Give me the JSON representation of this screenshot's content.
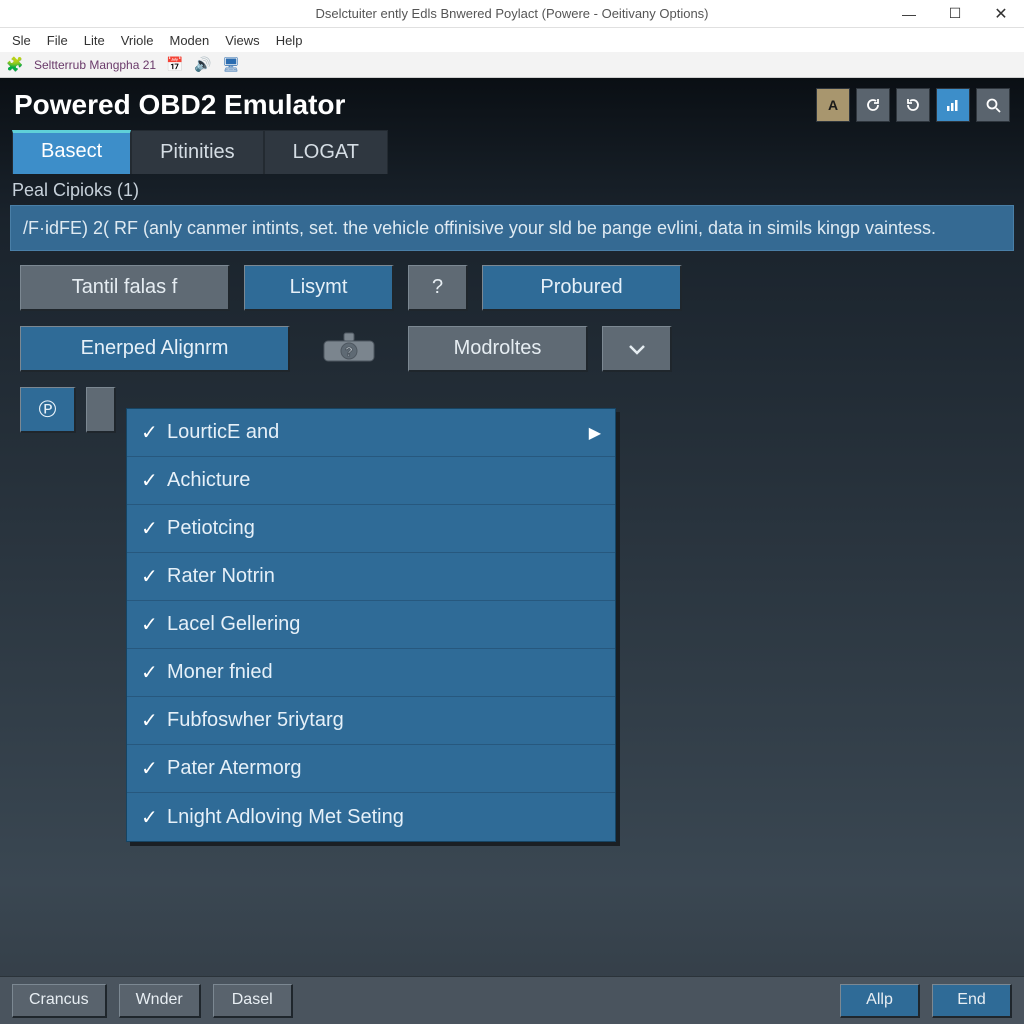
{
  "window": {
    "title": "Dselctuiter ently Edls Bnwered Poylact (Powere - Oeitivany Options)"
  },
  "menubar": [
    "Sle",
    "File",
    "Lite",
    "Vriole",
    "Moden",
    "Views",
    "Help"
  ],
  "toolbar": {
    "label": "Seltterrub Mangpha 21"
  },
  "app": {
    "title": "Powered OBD2 Emulator",
    "tabs": [
      {
        "label": "Basect",
        "active": true
      },
      {
        "label": "Pitinities",
        "active": false
      },
      {
        "label": "LOGAT",
        "active": false
      }
    ],
    "subtitle": "Peal Cipioks (1)",
    "banner": "/F·idFE) 2( RF (anly canmer intints, set. the vehicle offinisive your sld be pange evlini, data in simils kingp vaintess.",
    "row1": {
      "tantil": "Tantil falas f",
      "lsymt": "Lisymt",
      "help": "?",
      "probured": "Probured"
    },
    "row2": {
      "enerped": "Enerped Alignrm",
      "gear_help": "?",
      "modroltes": "Modroltes",
      "chev": "∨"
    },
    "phylo_icon": "℗",
    "dropdown": [
      {
        "label": "LourticE and",
        "has_sub": true
      },
      {
        "label": "Achicture",
        "has_sub": false
      },
      {
        "label": "Petiotcing",
        "has_sub": false
      },
      {
        "label": "Rater Notrin",
        "has_sub": false
      },
      {
        "label": "Lacel Gellering",
        "has_sub": false
      },
      {
        "label": "Moner fnied",
        "has_sub": false
      },
      {
        "label": "Fubfoswher 5riytarg",
        "has_sub": false
      },
      {
        "label": "Pater Atermorg",
        "has_sub": false
      },
      {
        "label": "Lnight Adloving Met Seting",
        "has_sub": false
      }
    ]
  },
  "footer": {
    "crancus": "Crancus",
    "wnder": "Wnder",
    "dasel": "Dasel",
    "alp": "Allp",
    "end": "End"
  }
}
